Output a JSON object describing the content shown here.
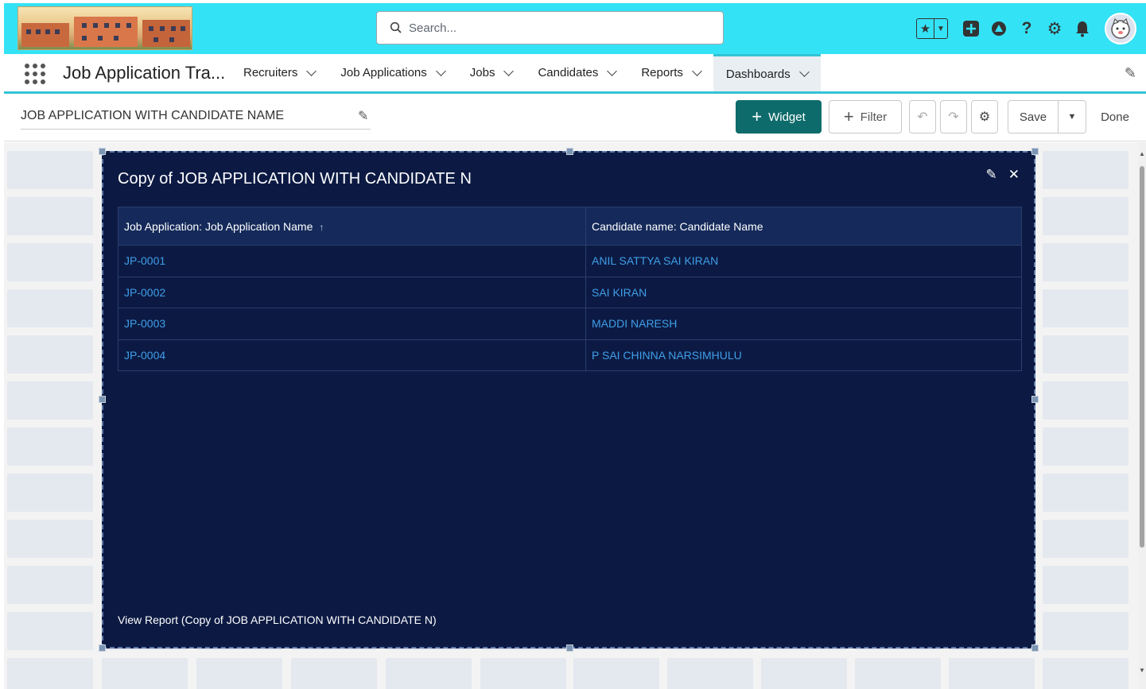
{
  "header": {
    "search_placeholder": "Search...",
    "icons": [
      "favorites-star-icon",
      "favorites-dropdown-icon",
      "add-icon",
      "trailhead-icon",
      "help-icon",
      "setup-gear-icon",
      "notifications-bell-icon",
      "user-avatar"
    ]
  },
  "nav": {
    "app_name": "Job Application Tra...",
    "items": [
      {
        "label": "Recruiters"
      },
      {
        "label": "Job Applications"
      },
      {
        "label": "Jobs"
      },
      {
        "label": "Candidates"
      },
      {
        "label": "Reports"
      },
      {
        "label": "Dashboards",
        "active": true
      }
    ]
  },
  "toolbar": {
    "dashboard_title": "JOB APPLICATION WITH CANDIDATE NAME",
    "widget_label": "Widget",
    "filter_label": "Filter",
    "save_label": "Save",
    "done_label": "Done"
  },
  "widget": {
    "title": "Copy of JOB APPLICATION WITH CANDIDATE N",
    "columns": [
      "Job Application: Job Application Name",
      "Candidate name: Candidate Name"
    ],
    "rows": [
      [
        "JP-0001",
        "ANIL SATTYA SAI KIRAN"
      ],
      [
        "JP-0002",
        "SAI KIRAN"
      ],
      [
        "JP-0003",
        "MADDI NARESH"
      ],
      [
        "JP-0004",
        "P SAI CHINNA NARSIMHULU"
      ]
    ],
    "footer_link": "View Report (Copy of JOB APPLICATION WITH CANDIDATE N)"
  },
  "colors": {
    "header_bar": "#34e2f5",
    "widget_bg": "#0c1a43",
    "link": "#3f9ee8",
    "primary_button": "#0e6b6b"
  }
}
